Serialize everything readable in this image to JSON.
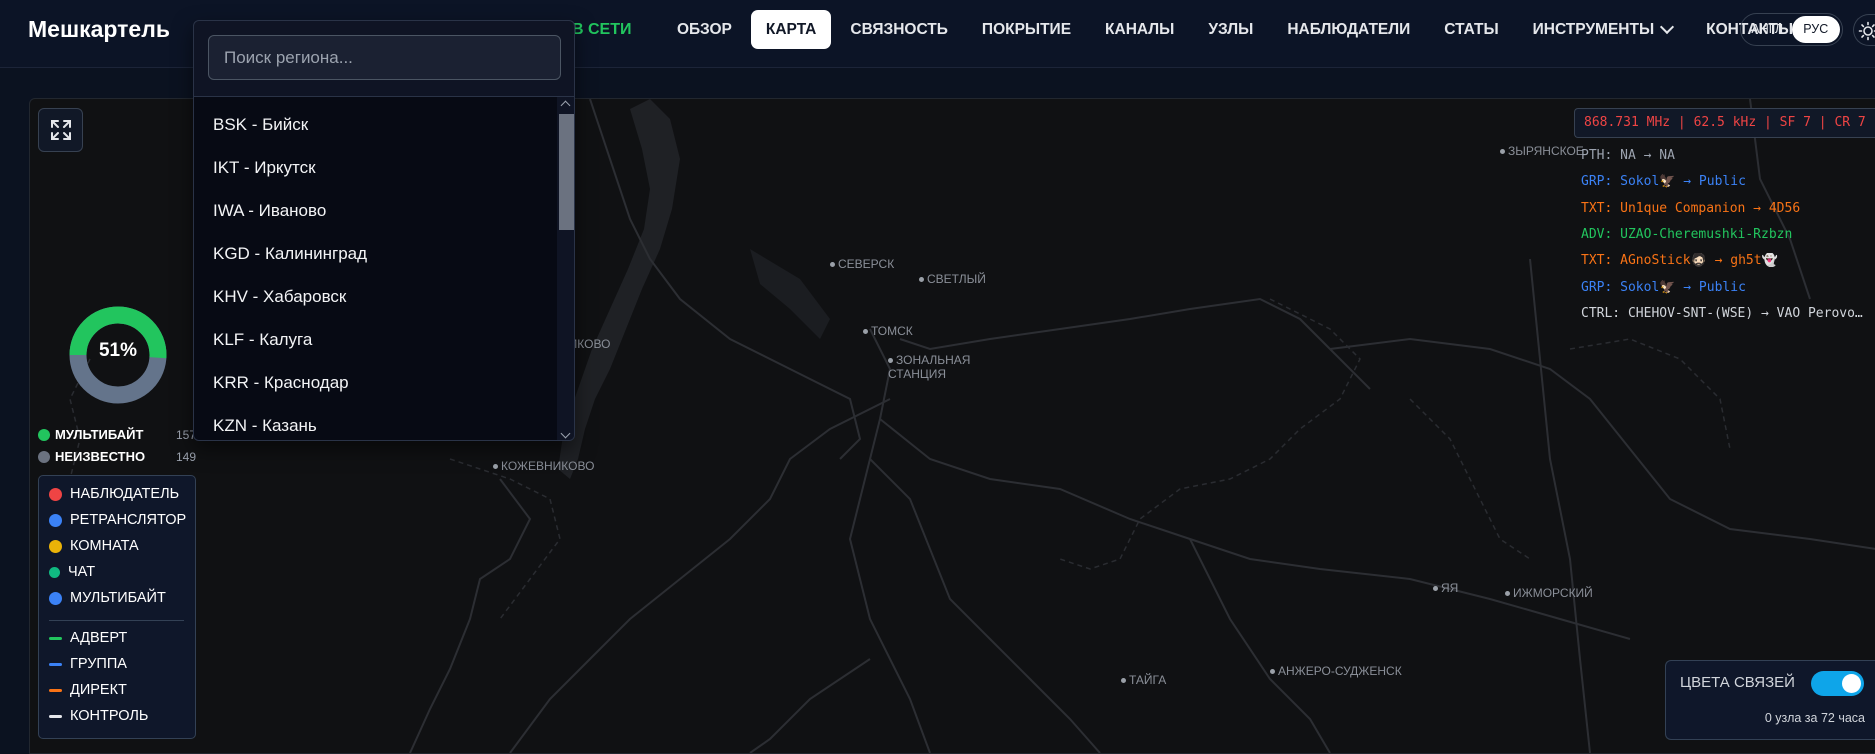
{
  "header": {
    "brand": "Мешкартель",
    "online_label": "В СЕТИ",
    "nav": [
      {
        "label": "ОБЗОР"
      },
      {
        "label": "КАРТА",
        "active": true
      },
      {
        "label": "СВЯЗНОСТЬ"
      },
      {
        "label": "ПОКРЫТИЕ"
      },
      {
        "label": "КАНАЛЫ"
      },
      {
        "label": "УЗЛЫ"
      },
      {
        "label": "НАБЛЮДАТЕЛИ"
      },
      {
        "label": "СТАТЫ"
      },
      {
        "label": "ИНСТРУМЕНТЫ",
        "has_dropdown": true
      },
      {
        "label": "КОНТАКТЫ"
      }
    ],
    "lang": {
      "en": "АНГЛ",
      "ru": "РУС",
      "selected": "ru"
    }
  },
  "region_dropdown": {
    "search_placeholder": "Поиск региона...",
    "items": [
      "BSK - Бийск",
      "IKT - Иркутск",
      "IWA - Иваново",
      "KGD - Калининград",
      "KHV - Хабаровск",
      "KLF - Калуга",
      "KRR - Краснодар",
      "KZN - Казань"
    ]
  },
  "map": {
    "places": [
      {
        "name": "СЕВЕРСК"
      },
      {
        "name": "СВЕТЛЫЙ"
      },
      {
        "name": "ТОМСК"
      },
      {
        "name": "ЗОНАЛЬНАЯ СТАНЦИЯ"
      },
      {
        "name": "КОЖЕВНИКОВО"
      },
      {
        "name": "ТАЙГА"
      },
      {
        "name": "АНЖЕРО-СУДЖЕНСК"
      },
      {
        "name": "ЯЯ"
      },
      {
        "name": "ИЖМОРСКИЙ"
      },
      {
        "name": "ЗЫРЯНСКОЕ"
      },
      {
        "name": "НИКОВО"
      }
    ]
  },
  "stats": {
    "donut_percent": 51,
    "donut_label": "51%",
    "donut_colors": {
      "primary": "#22c55e",
      "secondary": "#64748b"
    },
    "rows": [
      {
        "label": "МУЛЬТИБАЙТ",
        "count": "157",
        "color": "#22c55e"
      },
      {
        "label": "НЕИЗВЕСТНО",
        "count": "149",
        "color": "#6b7280"
      }
    ]
  },
  "legend": {
    "nodes": [
      {
        "label": "НАБЛЮДАТЕЛЬ",
        "color": "#ef4444"
      },
      {
        "label": "РЕТРАНСЛЯТОР",
        "color": "#3b82f6"
      },
      {
        "label": "КОМНАТА",
        "color": "#eab308"
      },
      {
        "label": "ЧАТ",
        "color": "#10b981"
      },
      {
        "label": "МУЛЬТИБАЙТ",
        "color": "#3b82f6"
      }
    ],
    "links": [
      {
        "label": "АДВЕРТ",
        "color": "#22c55e"
      },
      {
        "label": "ГРУППА",
        "color": "#3b82f6"
      },
      {
        "label": "ДИРЕКТ",
        "color": "#f97316"
      },
      {
        "label": "КОНТРОЛЬ",
        "color": "#e5e7eb"
      }
    ]
  },
  "feed": {
    "frequency": "868.731 MHz | 62.5 kHz | SF 7 | CR 7",
    "lines": [
      {
        "text": "PTH: NA → NA",
        "color": "#9ca3af"
      },
      {
        "text": "GRP: Sokol🦅 → Public",
        "color": "#3b82f6"
      },
      {
        "text": "TXT: Un1que Companion → 4D56",
        "color": "#f97316"
      },
      {
        "text": "ADV: UZAO-Cheremushki-Rzbzn",
        "color": "#22c55e"
      },
      {
        "text": "TXT: AGnoStick🧔🏻 → gh5t👻",
        "color": "#f97316"
      },
      {
        "text": "GRP: Sokol🦅 → Public",
        "color": "#3b82f6"
      },
      {
        "text": "CTRL: CHEHOV-SNT-(WSE) → VAO Perovo…",
        "color": "#d1d5db"
      }
    ]
  },
  "colors_panel": {
    "title": "ЦВЕТА СВЯЗЕЙ",
    "enabled": true,
    "subtitle": "0 узла за 72 часа"
  }
}
